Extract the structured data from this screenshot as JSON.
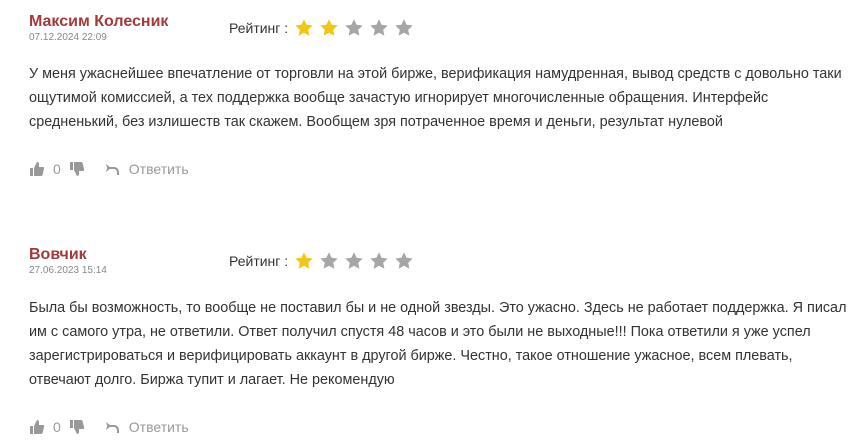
{
  "rating_label": "Рейтинг :",
  "reviews": [
    {
      "author": "Максим Колесник",
      "date": "07.12.2024 22:09",
      "stars": 2,
      "text": "У меня ужаснейшее впечатление от торговли на этой бирже, верификация намудренная, вывод средств с довольно таки ощутимой комиссией, а тех поддержка вообще зачастую игнорирует многочисленные обращения. Интерфейс средненький, без излишеств так скажем. Вообщем зря потраченное время и деньги, результат нулевой",
      "likes": "0",
      "reply_label": "Ответить"
    },
    {
      "author": "Вовчик",
      "date": "27.06.2023 15:14",
      "stars": 1,
      "text": "Была бы возможность, то вообще не поставил бы и не одной звезды. Это ужасно. Здесь не работает поддержка. Я писал им с самого утра, не ответили. Ответ получил спустя 48 часов и это были не выходные!!! Пока ответили я уже успел зарегистрироваться и верифицировать аккаунт в другой бирже. Честно, такое отношение ужасное, всем плевать, отвечают долго. Биржа тупит и лагает. Не рекомендую",
      "likes": "0",
      "reply_label": "Ответить"
    }
  ],
  "icons": {
    "like": "thumbs-up-icon",
    "dislike": "thumbs-down-icon",
    "reply": "reply-arrow-icon",
    "star": "star-icon"
  },
  "colors": {
    "author": "#a33a3a",
    "star_filled": "#f2c614",
    "star_empty": "#a6a6a6",
    "muted": "#999999"
  }
}
